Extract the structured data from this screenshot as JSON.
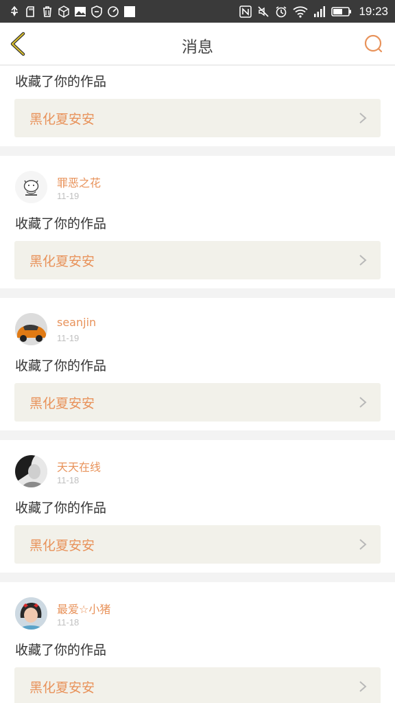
{
  "status_bar": {
    "time": "19:23",
    "icons_left": [
      "usb-icon",
      "sd-card-icon",
      "trash-icon",
      "box-icon",
      "image-icon",
      "shield-icon",
      "speed-icon",
      "square-icon"
    ],
    "icons_right": [
      "nfc-icon",
      "mute-icon",
      "alarm-icon",
      "wifi-icon",
      "signal-icon",
      "battery-icon"
    ]
  },
  "header": {
    "title": "消息"
  },
  "colors": {
    "accent": "#e8925a",
    "back_arrow": "#d9b92c",
    "work_bg": "#f2f1ea"
  },
  "partial_item": {
    "action": "收藏了你的作品",
    "work": "黑化夏安安"
  },
  "items": [
    {
      "user": "罪恶之花",
      "date": "11-19",
      "action": "收藏了你的作品",
      "work": "黑化夏安安"
    },
    {
      "user": "seanjin",
      "date": "11-19",
      "action": "收藏了你的作品",
      "work": "黑化夏安安"
    },
    {
      "user": "天天在线",
      "date": "11-18",
      "action": "收藏了你的作品",
      "work": "黑化夏安安"
    },
    {
      "user": "最爱☆小猪",
      "date": "11-18",
      "action": "收藏了你的作品",
      "work": "黑化夏安安"
    }
  ]
}
